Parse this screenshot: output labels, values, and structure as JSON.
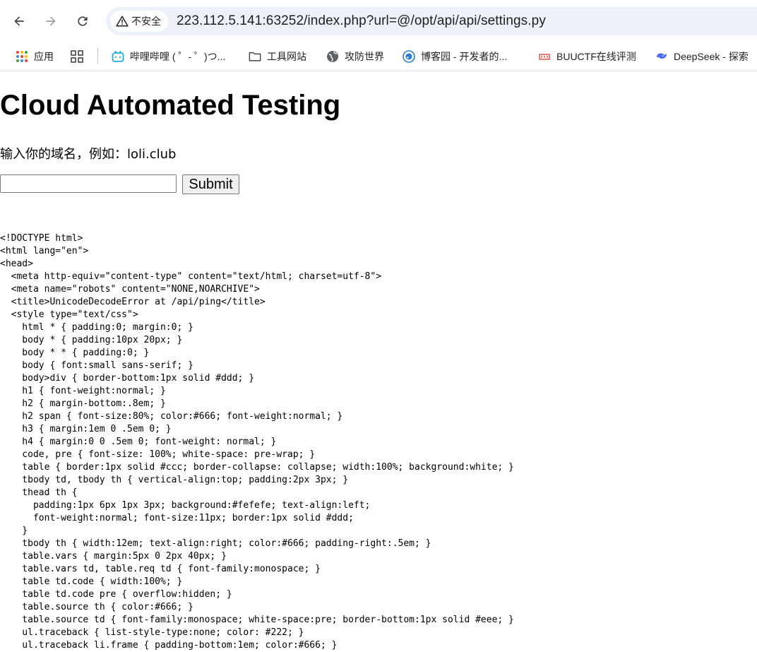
{
  "browser": {
    "security_label": "不安全",
    "url": "223.112.5.141:63252/index.php?url=@/opt/api/api/settings.py",
    "bookmarks": [
      {
        "label": "应用",
        "icon": "apps-grid-icon"
      },
      {
        "label": "",
        "icon": "tab-groups-icon"
      },
      {
        "label": "哔哩哔哩 ( ゜- ゜)つ...",
        "icon": "bilibili-icon"
      },
      {
        "label": "工具网站",
        "icon": "folder-icon"
      },
      {
        "label": "攻防世界",
        "icon": "globe-icon"
      },
      {
        "label": "博客园 - 开发者的...",
        "icon": "cnblogs-icon"
      },
      {
        "label": "BUUCTF在线评测",
        "icon": "buuctf-icon"
      },
      {
        "label": "DeepSeek - 探索",
        "icon": "deepseek-icon"
      }
    ]
  },
  "page": {
    "title": "Cloud Automated Testing",
    "prompt": "输入你的域名，例如：loli.club",
    "input_value": "",
    "submit_label": "Submit",
    "source_lines": [
      "<!DOCTYPE html>",
      "<html lang=\"en\">",
      "<head>",
      "  <meta http-equiv=\"content-type\" content=\"text/html; charset=utf-8\">",
      "  <meta name=\"robots\" content=\"NONE,NOARCHIVE\">",
      "  <title>UnicodeDecodeError at /api/ping</title>",
      "  <style type=\"text/css\">",
      "    html * { padding:0; margin:0; }",
      "    body * { padding:10px 20px; }",
      "    body * * { padding:0; }",
      "    body { font:small sans-serif; }",
      "    body>div { border-bottom:1px solid #ddd; }",
      "    h1 { font-weight:normal; }",
      "    h2 { margin-bottom:.8em; }",
      "    h2 span { font-size:80%; color:#666; font-weight:normal; }",
      "    h3 { margin:1em 0 .5em 0; }",
      "    h4 { margin:0 0 .5em 0; font-weight: normal; }",
      "    code, pre { font-size: 100%; white-space: pre-wrap; }",
      "    table { border:1px solid #ccc; border-collapse: collapse; width:100%; background:white; }",
      "    tbody td, tbody th { vertical-align:top; padding:2px 3px; }",
      "    thead th {",
      "      padding:1px 6px 1px 3px; background:#fefefe; text-align:left;",
      "      font-weight:normal; font-size:11px; border:1px solid #ddd;",
      "    }",
      "    tbody th { width:12em; text-align:right; color:#666; padding-right:.5em; }",
      "    table.vars { margin:5px 0 2px 40px; }",
      "    table.vars td, table.req td { font-family:monospace; }",
      "    table td.code { width:100%; }",
      "    table td.code pre { overflow:hidden; }",
      "    table.source th { color:#666; }",
      "    table.source td { font-family:monospace; white-space:pre; border-bottom:1px solid #eee; }",
      "    ul.traceback { list-style-type:none; color: #222; }",
      "    ul.traceback li.frame { padding-bottom:1em; color:#666; }"
    ]
  }
}
